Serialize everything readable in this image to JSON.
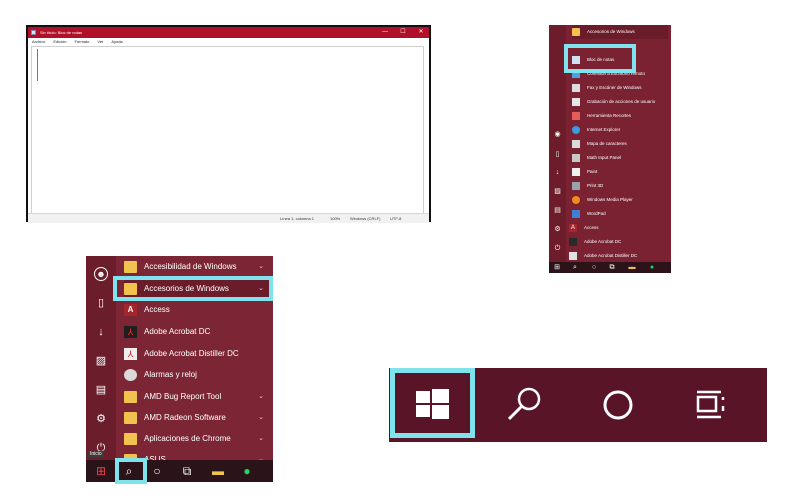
{
  "notepad": {
    "title": "Sin título: Bloc de notas",
    "window_controls": [
      "—",
      "☐",
      "✕"
    ],
    "menu": [
      "Archivo",
      "Edición",
      "Formato",
      "Ver",
      "Ayuda"
    ],
    "status": {
      "position": "Línea 1, columna 1",
      "zoom": "100%",
      "line_ending": "Windows (CRLF)",
      "encoding": "UTF-8"
    }
  },
  "start_menu_right": {
    "items": [
      {
        "label": "Accesorios de Windows",
        "icon": "folder-icon"
      },
      {
        "label": "Bloc de notas",
        "icon": "notepad-icon"
      },
      {
        "label": "Conexión a Escritorio remoto",
        "icon": "remote-desktop-icon"
      },
      {
        "label": "Fax y Escáner de Windows",
        "icon": "fax-icon"
      },
      {
        "label": "Grabación de acciones de usuario",
        "icon": "steps-recorder-icon"
      },
      {
        "label": "Herramienta Recortes",
        "icon": "snipping-tool-icon"
      },
      {
        "label": "Internet Explorer",
        "icon": "internet-explorer-icon"
      },
      {
        "label": "Mapa de caracteres",
        "icon": "character-map-icon"
      },
      {
        "label": "Math Input Panel",
        "icon": "math-input-icon"
      },
      {
        "label": "Paint",
        "icon": "paint-icon"
      },
      {
        "label": "Print 3D",
        "icon": "print-3d-icon"
      },
      {
        "label": "Windows Media Player",
        "icon": "media-player-icon"
      },
      {
        "label": "WordPad",
        "icon": "wordpad-icon"
      },
      {
        "label": "Access",
        "icon": "access-icon"
      },
      {
        "label": "Adobe Acrobat DC",
        "icon": "acrobat-icon"
      },
      {
        "label": "Adobe Acrobat Distiller DC",
        "icon": "acrobat-distiller-icon"
      }
    ]
  },
  "start_menu_left": {
    "items": [
      {
        "label": "Accesibilidad de Windows",
        "icon": "folder-icon",
        "chevron": "⌄"
      },
      {
        "label": "Accesorios de Windows",
        "icon": "folder-icon",
        "chevron": "⌄"
      },
      {
        "label": "Access",
        "icon": "access-icon",
        "chevron": ""
      },
      {
        "label": "Adobe Acrobat DC",
        "icon": "acrobat-icon",
        "chevron": ""
      },
      {
        "label": "Adobe Acrobat Distiller DC",
        "icon": "acrobat-distiller-icon",
        "chevron": ""
      },
      {
        "label": "Alarmas y reloj",
        "icon": "clock-icon",
        "chevron": ""
      },
      {
        "label": "AMD Bug Report Tool",
        "icon": "folder-icon",
        "chevron": "⌄"
      },
      {
        "label": "AMD Radeon Software",
        "icon": "folder-icon",
        "chevron": "⌄"
      },
      {
        "label": "Aplicaciones de Chrome",
        "icon": "folder-icon",
        "chevron": "⌄"
      },
      {
        "label": "ASUS",
        "icon": "folder-icon",
        "chevron": "⌄"
      }
    ],
    "tooltip": "Inicio"
  },
  "colors": {
    "highlight": "#7fe3ee",
    "menu_bg": "#7c2635",
    "taskbar": "#2a1419",
    "notepad_title": "#b0102a"
  }
}
